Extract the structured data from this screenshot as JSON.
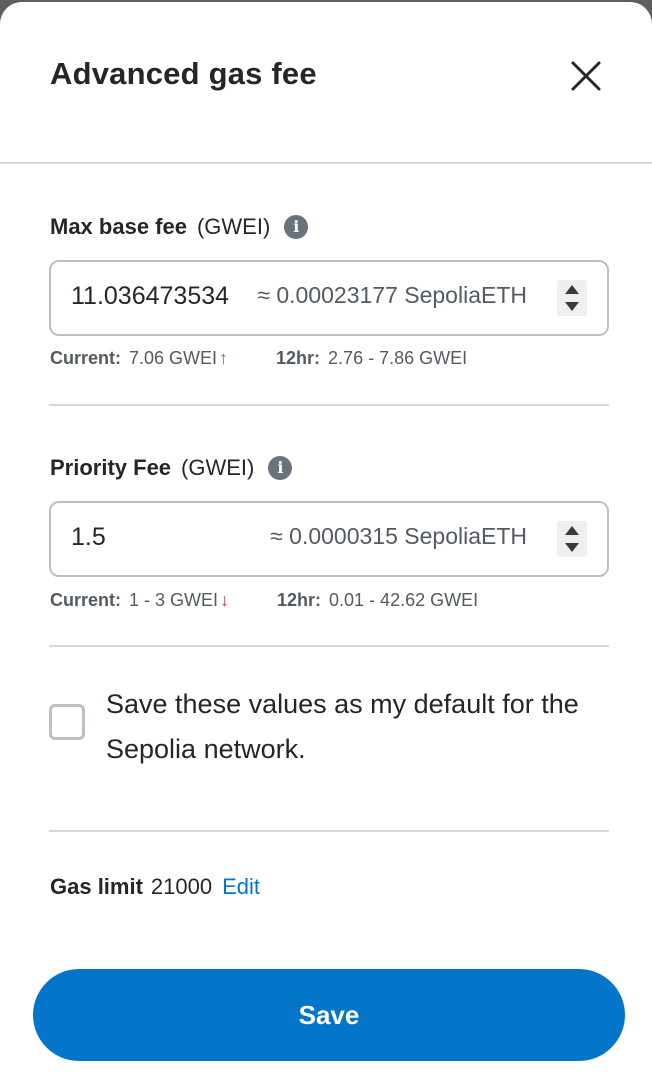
{
  "header": {
    "title": "Advanced gas fee"
  },
  "max_base_fee": {
    "label": "Max base fee",
    "unit": "(GWEI)",
    "value": "11.036473534",
    "conversion": "≈ 0.00023177 SepoliaETH",
    "current_label": "Current:",
    "current_value": "7.06 GWEI",
    "current_trend": "↑",
    "range_label": "12hr:",
    "range_value": "2.76 - 7.86 GWEI"
  },
  "priority_fee": {
    "label": "Priority Fee",
    "unit": "(GWEI)",
    "value": "1.5",
    "conversion": "≈ 0.0000315 SepoliaETH",
    "current_label": "Current:",
    "current_value": "1 - 3 GWEI",
    "current_trend": "↓",
    "range_label": "12hr:",
    "range_value": "0.01 - 42.62 GWEI"
  },
  "default_checkbox": {
    "checked": false,
    "label": "Save these values as my default for the Sepolia network."
  },
  "gas_limit": {
    "label": "Gas limit",
    "value": "21000",
    "edit_label": "Edit"
  },
  "save_label": "Save",
  "icons": {
    "close": "close-icon",
    "info": "info-icon",
    "stepper": "stepper-icon",
    "trend_up": "arrow-up-icon",
    "trend_down": "arrow-down-icon"
  },
  "colors": {
    "primary": "#0376c9",
    "trend_up": "#28a745",
    "trend_down": "#d73a49"
  }
}
